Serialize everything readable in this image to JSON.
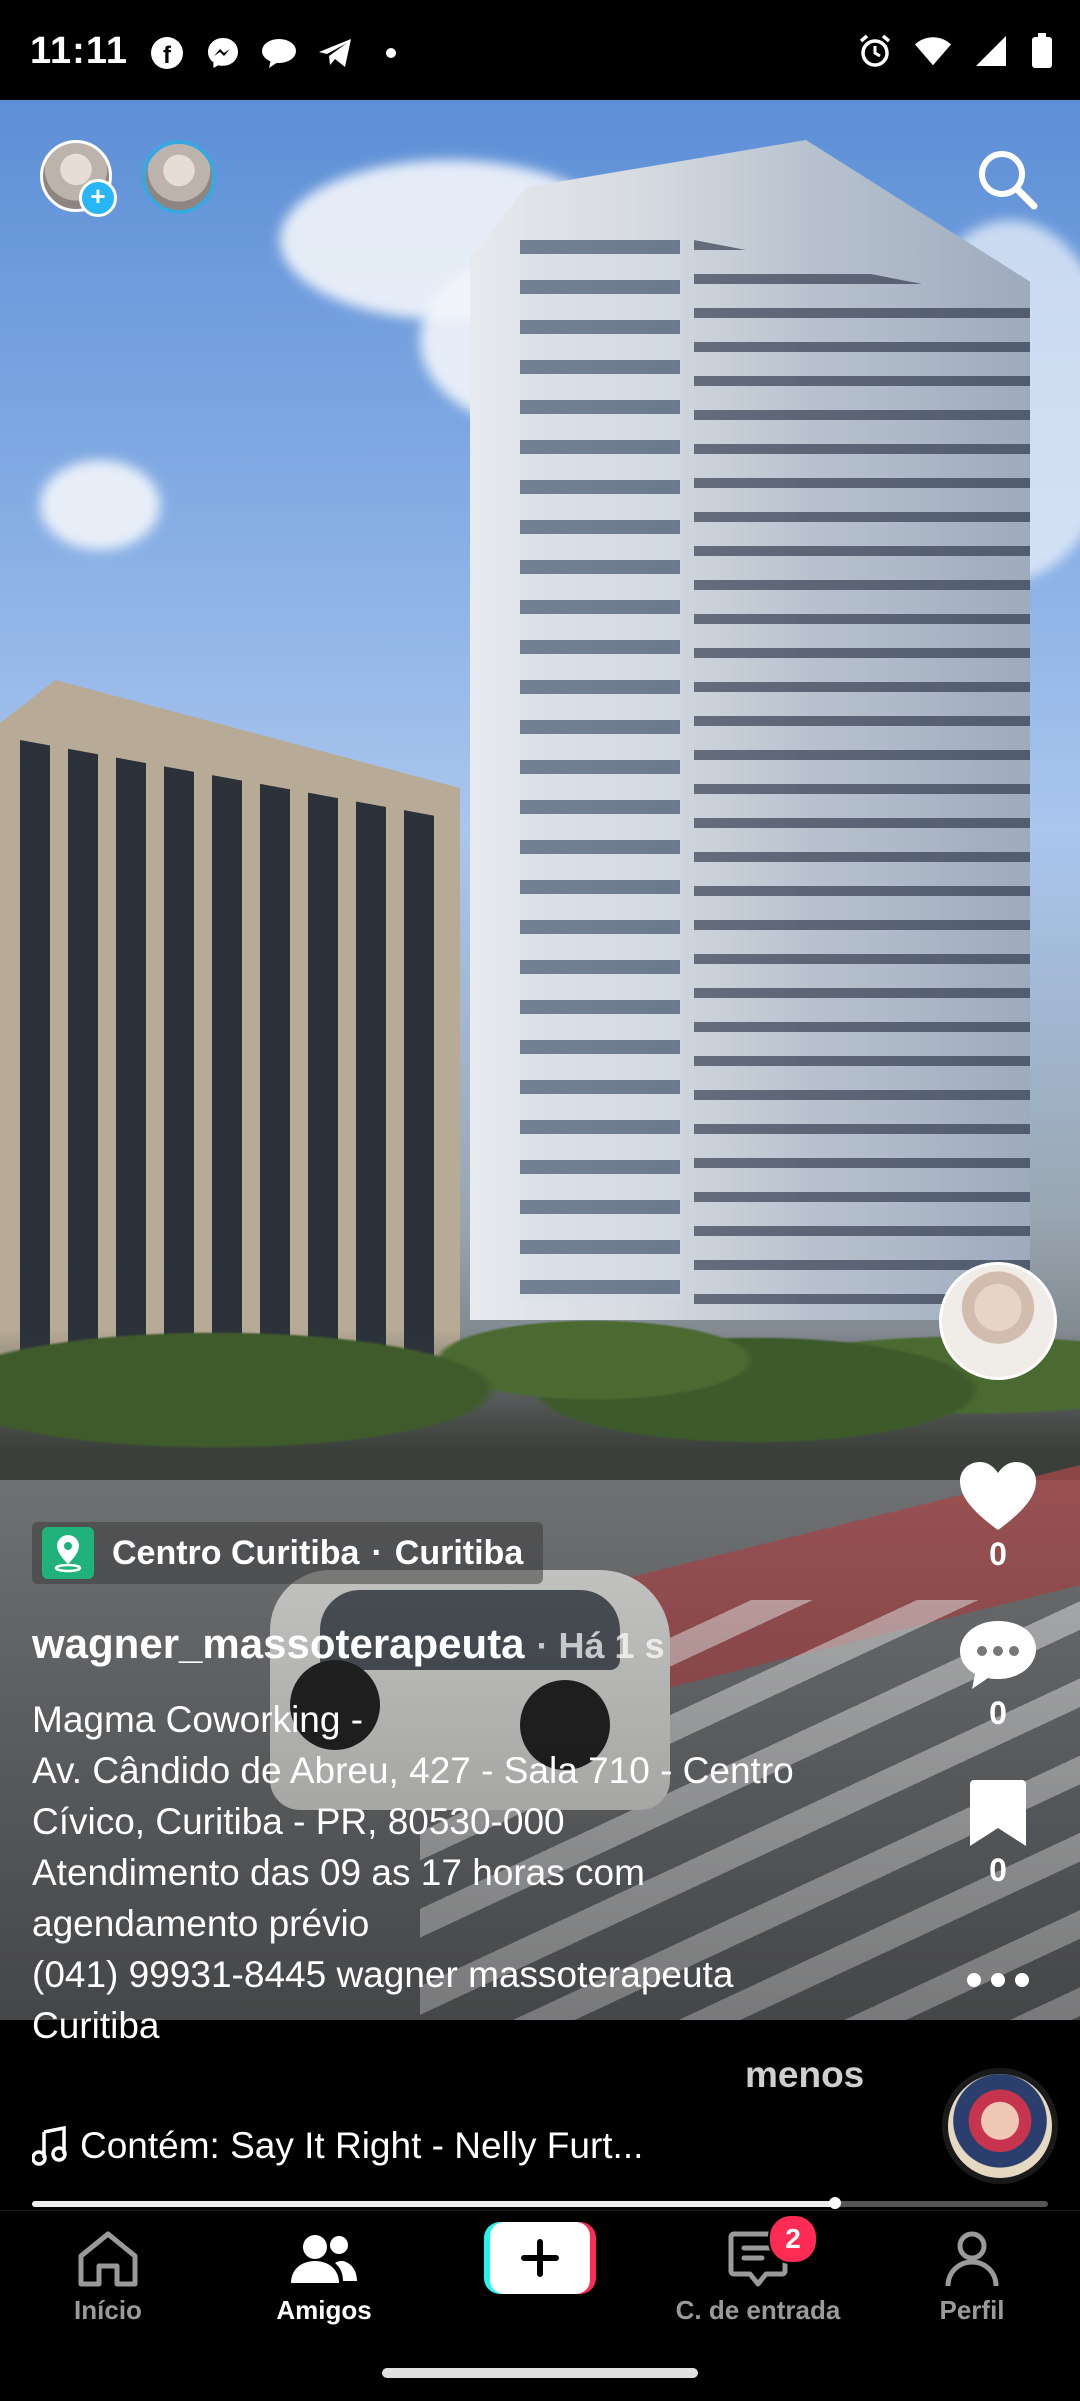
{
  "status_bar": {
    "time": "11:11",
    "left_icons": [
      "facebook-icon",
      "messenger-icon",
      "chat-bubble-icon",
      "telegram-icon",
      "dot-icon"
    ],
    "right_icons": [
      "alarm-icon",
      "wifi-icon",
      "signal-icon",
      "battery-icon"
    ]
  },
  "feed": {
    "location": "Centro Curitiba",
    "location_separator": "·",
    "city": "Curitiba",
    "username": "wagner_massoterapeuta",
    "time_ago": "· Há 1 s",
    "caption_lines": [
      "Magma Coworking -",
      "Av. Cândido de Abreu, 427 - Sala 710 - Centro",
      "Cívico, Curitiba - PR, 80530-000",
      "Atendimento das 09 as 17 horas com",
      "agendamento prévio",
      "(041) 99931-8445 wagner massoterapeuta",
      "Curitiba"
    ],
    "less_label": "menos",
    "music": "Contém: Say It Right - Nelly Furt...",
    "progress": 0.79
  },
  "actions": {
    "likes": "0",
    "comments": "0",
    "saves": "0"
  },
  "nav": {
    "home": "Início",
    "friends": "Amigos",
    "inbox": "C. de entrada",
    "inbox_badge": "2",
    "profile": "Perfil"
  },
  "colors": {
    "accent_red": "#fe2c55",
    "accent_cyan": "#25f4ee",
    "location_green": "#1fb37b"
  }
}
